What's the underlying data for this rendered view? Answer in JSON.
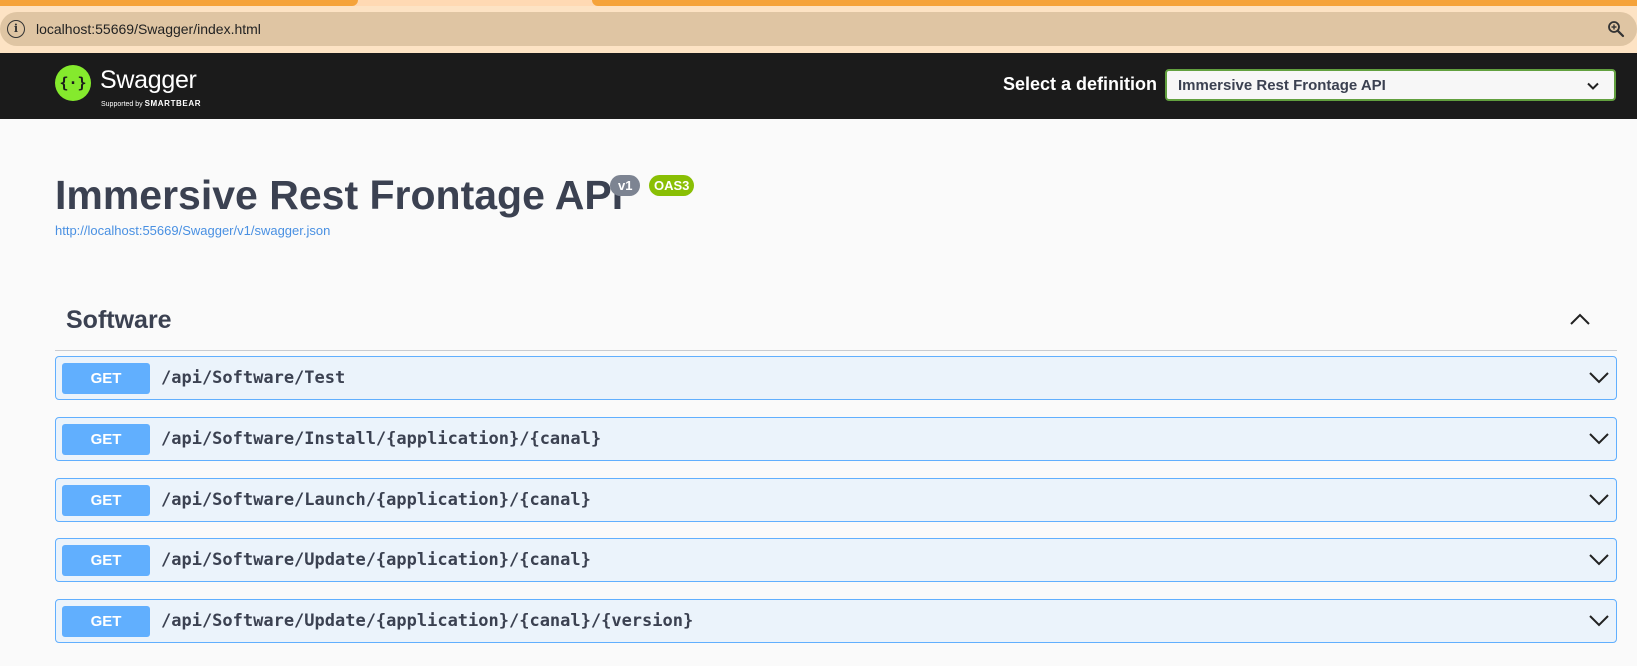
{
  "browser": {
    "url": "localhost:55669/Swagger/index.html"
  },
  "topbar": {
    "logo_name": "Swagger",
    "logo_supported": "Supported by",
    "logo_company": "SMARTBEAR",
    "definition_label": "Select a definition",
    "definition_selected": "Immersive Rest Frontage API"
  },
  "info": {
    "title": "Immersive Rest Frontage API",
    "version": "v1",
    "oas": "OAS3",
    "spec_url": "http://localhost:55669/Swagger/v1/swagger.json"
  },
  "tag": {
    "name": "Software"
  },
  "operations": [
    {
      "method": "GET",
      "path": "/api/Software/Test"
    },
    {
      "method": "GET",
      "path": "/api/Software/Install/{application}/{canal}"
    },
    {
      "method": "GET",
      "path": "/api/Software/Launch/{application}/{canal}"
    },
    {
      "method": "GET",
      "path": "/api/Software/Update/{application}/{canal}"
    },
    {
      "method": "GET",
      "path": "/api/Software/Update/{application}/{canal}/{version}"
    }
  ],
  "colors": {
    "get_method": "#61affe",
    "get_background": "#ebf3fb",
    "topbar": "#1b1b1b",
    "swagger_green": "#85ea2d",
    "oas_badge": "#89bf04",
    "version_badge": "#7d8492"
  }
}
